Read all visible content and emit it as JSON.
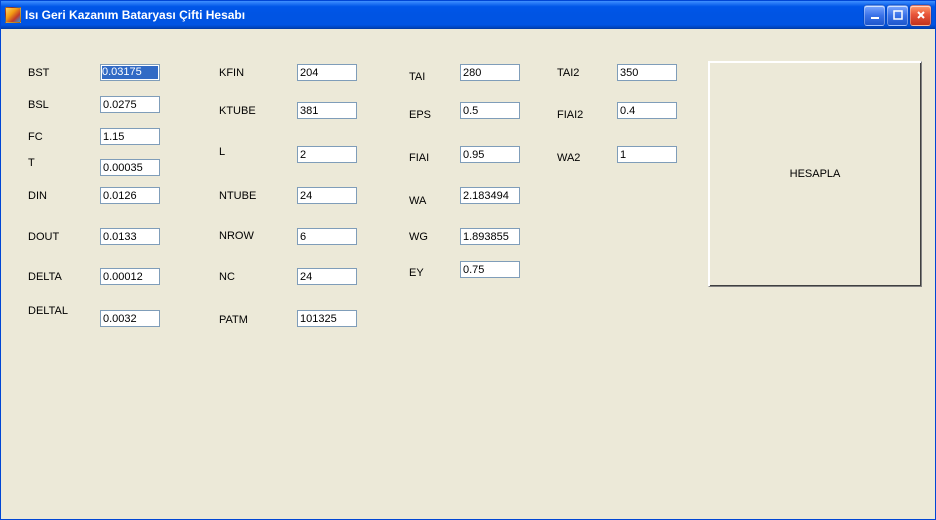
{
  "window": {
    "title": "Isı Geri Kazanım Bataryası Çifti Hesabı"
  },
  "columns": {
    "c1": {
      "BST": {
        "label": "BST",
        "value": "0.03175"
      },
      "BSL": {
        "label": "BSL",
        "value": "0.0275"
      },
      "FC": {
        "label": "FC",
        "value": "1.15"
      },
      "T": {
        "label": "T",
        "value": "0.00035"
      },
      "DIN": {
        "label": "DIN",
        "value": "0.0126"
      },
      "DOUT": {
        "label": "DOUT",
        "value": "0.0133"
      },
      "DELTA": {
        "label": "DELTA",
        "value": "0.00012"
      },
      "DELTAL": {
        "label": "DELTAL",
        "value": "0.0032"
      }
    },
    "c2": {
      "KFIN": {
        "label": "KFIN",
        "value": "204"
      },
      "KTUBE": {
        "label": "KTUBE",
        "value": "381"
      },
      "L": {
        "label": "L",
        "value": "2"
      },
      "NTUBE": {
        "label": "NTUBE",
        "value": "24"
      },
      "NROW": {
        "label": "NROW",
        "value": "6"
      },
      "NC": {
        "label": "NC",
        "value": "24"
      },
      "PATM": {
        "label": "PATM",
        "value": "101325"
      }
    },
    "c3": {
      "TAI": {
        "label": "TAI",
        "value": "280"
      },
      "EPS": {
        "label": "EPS",
        "value": "0.5"
      },
      "FIAI": {
        "label": "FIAI",
        "value": "0.95"
      },
      "WA": {
        "label": "WA",
        "value": "2.183494"
      },
      "WG": {
        "label": "WG",
        "value": "1.893855"
      },
      "EY": {
        "label": "EY",
        "value": "0.75"
      }
    },
    "c4": {
      "TAI2": {
        "label": "TAI2",
        "value": "350"
      },
      "FIAI2": {
        "label": "FIAI2",
        "value": "0.4"
      },
      "WA2": {
        "label": "WA2",
        "value": "1"
      }
    }
  },
  "button": {
    "hesapla": "HESAPLA"
  }
}
